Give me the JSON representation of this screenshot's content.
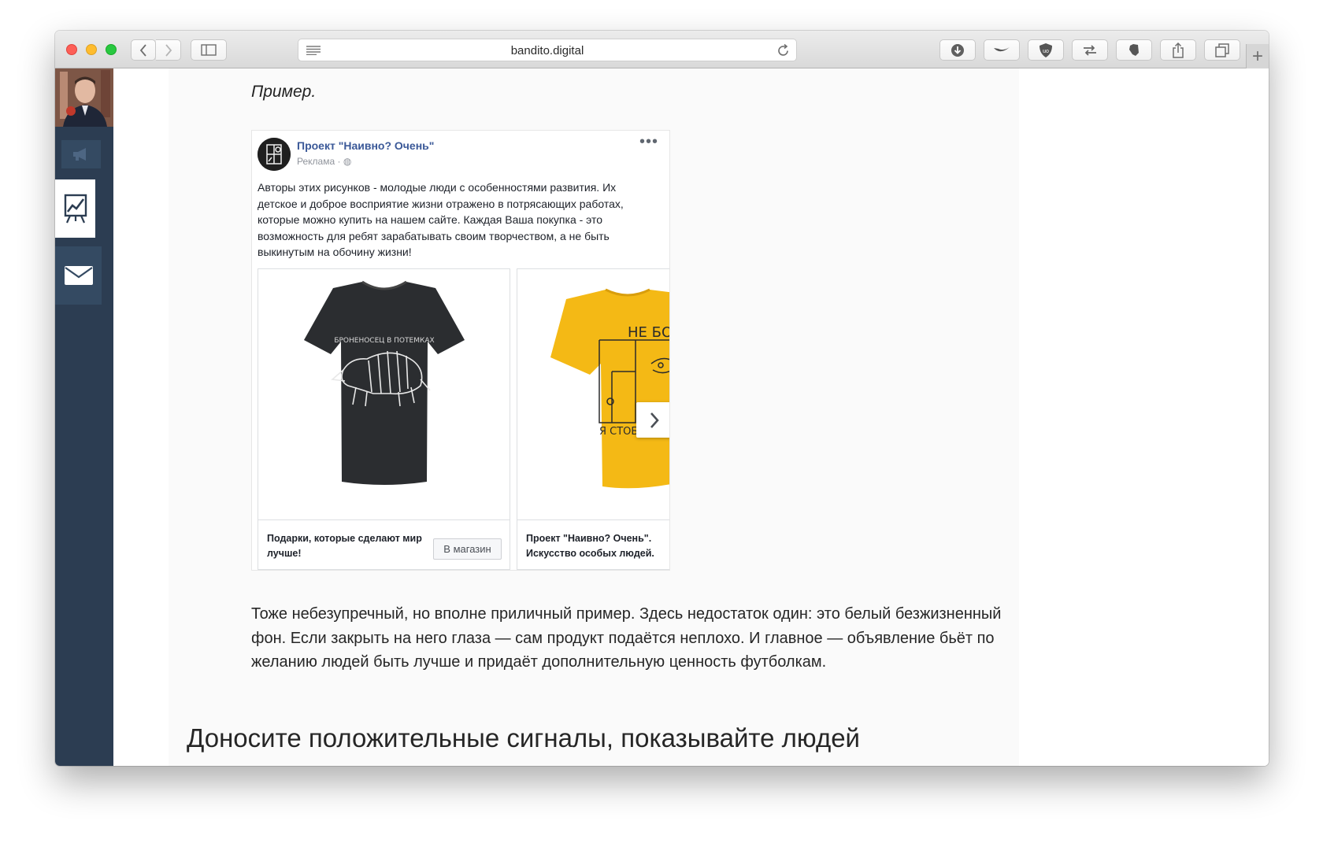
{
  "browser": {
    "url": "bandito.digital",
    "toolbar_icons": [
      "back-icon",
      "forward-icon",
      "sidebar-icon",
      "reader-icon",
      "reload-icon",
      "download-icon",
      "extension-icon",
      "shield-icon",
      "sync-icon",
      "evernote-icon",
      "share-icon",
      "tabs-icon",
      "new-tab-icon"
    ]
  },
  "sidebar": {
    "items": [
      {
        "name": "author-avatar"
      },
      {
        "name": "megaphone-icon"
      },
      {
        "name": "chart-icon"
      },
      {
        "name": "mail-icon"
      }
    ],
    "colors": {
      "background": "#2c3d52",
      "button": "#344a62"
    }
  },
  "article": {
    "intro": "Пример.",
    "paragraph": "Тоже небезупречный, но вполне приличный пример. Здесь недостаток один: это белый безжизненный фон. Если закрыть на него глаза — сам продукт подаётся неплохо. И главное — объявление бьёт по желанию людей быть лучше и придаёт дополнительную ценность футболкам.",
    "heading": "Доносите положительные сигналы, показывайте людей"
  },
  "ad_post": {
    "page_name": "Проект \"Наивно? Очень\"",
    "label": "Реклама",
    "more": "•••",
    "text": "Авторы этих рисунков - молодые люди с особенностями развития. Их детское и доброе восприятие жизни отражено в потрясающих работах, которые можно купить на нашем сайте. Каждая Ваша покупка - это возможность для ребят зарабатывать своим творчеством, а не быть выкинутым на обочину жизни!",
    "cards": [
      {
        "title": "Подарки, которые сделают мир лучше!",
        "button": "В магазин",
        "shirt_text": "БРОНЕНОСЕЦ В ПОТЕМКАХ",
        "shirt_color": "#2b2d30"
      },
      {
        "title": "Проект \"Наивно? Очень\". Искусство особых людей.",
        "shirt_text_top": "НЕ БО",
        "shirt_text_bottom": "Я СТОБОЙ",
        "shirt_color": "#f4b915"
      }
    ],
    "colors": {
      "name": "#3b5998",
      "meta": "#90949c"
    }
  },
  "chat_widget": {
    "icon": "chat-icon",
    "color": "#2d6386"
  }
}
